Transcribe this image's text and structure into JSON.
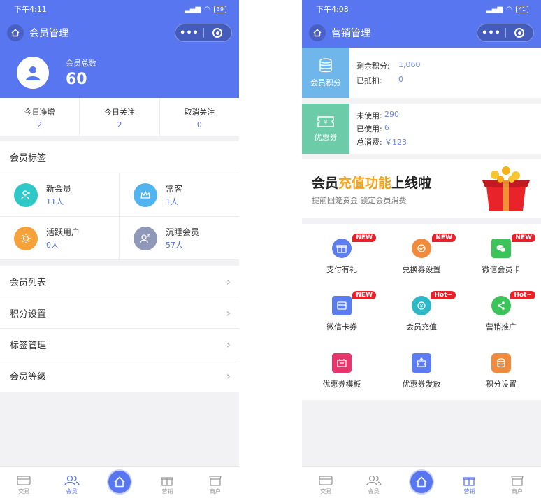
{
  "left": {
    "status": {
      "time": "下午4:11",
      "battery": "39"
    },
    "nav": {
      "title": "会员管理",
      "capsule_dots": "•••"
    },
    "header": {
      "label": "会员总数",
      "value": "60"
    },
    "stats": [
      {
        "label": "今日净增",
        "value": "2"
      },
      {
        "label": "今日关注",
        "value": "2"
      },
      {
        "label": "取消关注",
        "value": "0"
      }
    ],
    "tags_title": "会员标签",
    "tags": [
      {
        "name": "新会员",
        "count": "11人",
        "icon": "add-user-icon",
        "color": "#2ec8c8"
      },
      {
        "name": "常客",
        "count": "1人",
        "icon": "crown-icon",
        "color": "#52b4ee"
      },
      {
        "name": "活跃用户",
        "count": "0人",
        "icon": "sun-icon",
        "color": "#f6a23a"
      },
      {
        "name": "沉睡会员",
        "count": "57人",
        "icon": "sleep-user-icon",
        "color": "#8f98b8"
      }
    ],
    "menu": [
      {
        "label": "会员列表"
      },
      {
        "label": "积分设置"
      },
      {
        "label": "标签管理"
      },
      {
        "label": "会员等级"
      }
    ]
  },
  "right": {
    "status": {
      "time": "下午4:08",
      "battery": "41"
    },
    "nav": {
      "title": "营销管理",
      "capsule_dots": "•••"
    },
    "points_card": {
      "side_label": "会员积分",
      "color": "#6fb6ea",
      "rows": [
        {
          "k": "剩余积分:",
          "v": "1,060"
        },
        {
          "k": "已抵扣:",
          "v": "0"
        }
      ]
    },
    "coupon_card": {
      "side_label": "优惠券",
      "color": "#6ccba9",
      "rows": [
        {
          "k": "未使用:",
          "v": "290"
        },
        {
          "k": "已使用:",
          "v": "6"
        },
        {
          "k": "总消费:",
          "v": "￥123"
        }
      ]
    },
    "banner": {
      "title_a": "会员",
      "title_b": "充值功能",
      "title_c": "上线啦",
      "subtitle": "提前回笼资金 锁定会员消费"
    },
    "grid": [
      {
        "label": "支付有礼",
        "badge": "NEW",
        "icon": "gift-icon",
        "color": "#5c7cf2"
      },
      {
        "label": "兑换券设置",
        "badge": "NEW",
        "icon": "ticket-icon",
        "color": "#f08a3c"
      },
      {
        "label": "微信会员卡",
        "badge": "NEW",
        "icon": "wechat-icon",
        "color": "#3cc45a"
      },
      {
        "label": "微信卡券",
        "badge": "NEW",
        "icon": "card-icon",
        "color": "#5c7cf2"
      },
      {
        "label": "会员充值",
        "badge": "Hot~",
        "icon": "recharge-icon",
        "color": "#2db7c8"
      },
      {
        "label": "营销推广",
        "badge": "Hot~",
        "icon": "share-icon",
        "color": "#3cc45a"
      },
      {
        "label": "优惠券模板",
        "badge": "",
        "icon": "coupon-template-icon",
        "color": "#e8356c"
      },
      {
        "label": "优惠券发放",
        "badge": "",
        "icon": "coupon-send-icon",
        "color": "#5c7cf2"
      },
      {
        "label": "积分设置",
        "badge": "",
        "icon": "points-icon",
        "color": "#f08a3c"
      }
    ]
  },
  "tabs": [
    {
      "label": "交易"
    },
    {
      "label": "会员"
    },
    {
      "label": "营销"
    },
    {
      "label": "商户"
    }
  ],
  "colors": {
    "brand": "#5876f0",
    "accent": "#f5a21a",
    "badge": "#e8202a"
  }
}
